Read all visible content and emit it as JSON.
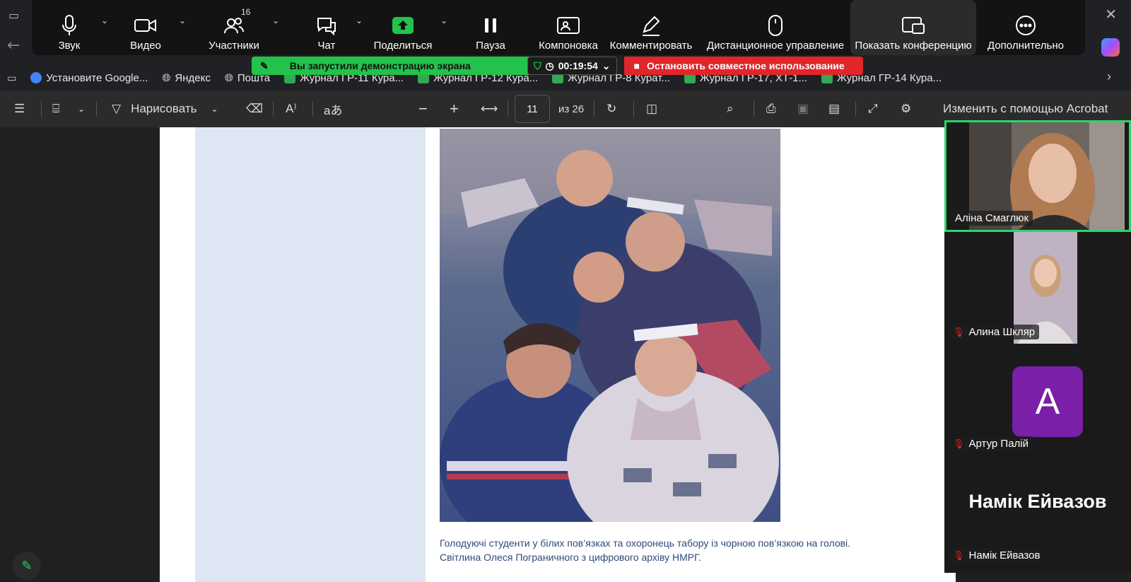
{
  "zoom_toolbar": {
    "audio": "Звук",
    "video": "Видео",
    "participants": "Участники",
    "participants_count": "16",
    "chat": "Чат",
    "share": "Поделиться",
    "pause": "Пауза",
    "layout": "Компоновка",
    "annotate": "Комментировать",
    "remote_control": "Дистанционное управление",
    "show_meeting": "Показать конференцию",
    "more": "Дополнительно"
  },
  "share_banner": {
    "message": "Вы запустили демонстрацию экрана",
    "timer": "00:19:54",
    "stop": "Остановить совместное использование"
  },
  "bookmarks": [
    {
      "label": "Установите Google...",
      "color": "#4285f4"
    },
    {
      "label": "Яндекс",
      "color": "#cccccc"
    },
    {
      "label": "Пошта",
      "color": "#cccccc"
    },
    {
      "label": "Журнал ГР-11 Кура...",
      "color": "#34a853"
    },
    {
      "label": "Журнал ГР-12 Кура...",
      "color": "#34a853"
    },
    {
      "label": "Журнал ГР-8 Курат...",
      "color": "#34a853"
    },
    {
      "label": "Журнал ГР-17, ХТ-1...",
      "color": "#34a853"
    },
    {
      "label": "Журнал ГР-14 Кура...",
      "color": "#34a853"
    }
  ],
  "pdf_toolbar": {
    "draw": "Нарисовать",
    "page_number": "11",
    "page_total": "из 26",
    "edit_acrobat": "Изменить с помощью Acrobat"
  },
  "document": {
    "caption_line1": "Голодуючі студенти у білих пов’язках та охоронець табору із чорною пов’язкою на голові.",
    "caption_line2": "Світлина Олеся Пограничного з цифрового архіву НМРГ."
  },
  "participants": [
    {
      "name": "Аліна Смаглюк",
      "muted": false,
      "speaking": true
    },
    {
      "name": "Алина Шкляр",
      "muted": true
    },
    {
      "name": "Артур Палій",
      "muted": true,
      "initial": "A"
    },
    {
      "name": "Намік Ейвазов",
      "muted": true
    }
  ],
  "colors": {
    "share_green": "#23c24a",
    "stop_red": "#e0262b",
    "speaking_border": "#2ad66a",
    "avatar_purple": "#7a1fa8"
  }
}
